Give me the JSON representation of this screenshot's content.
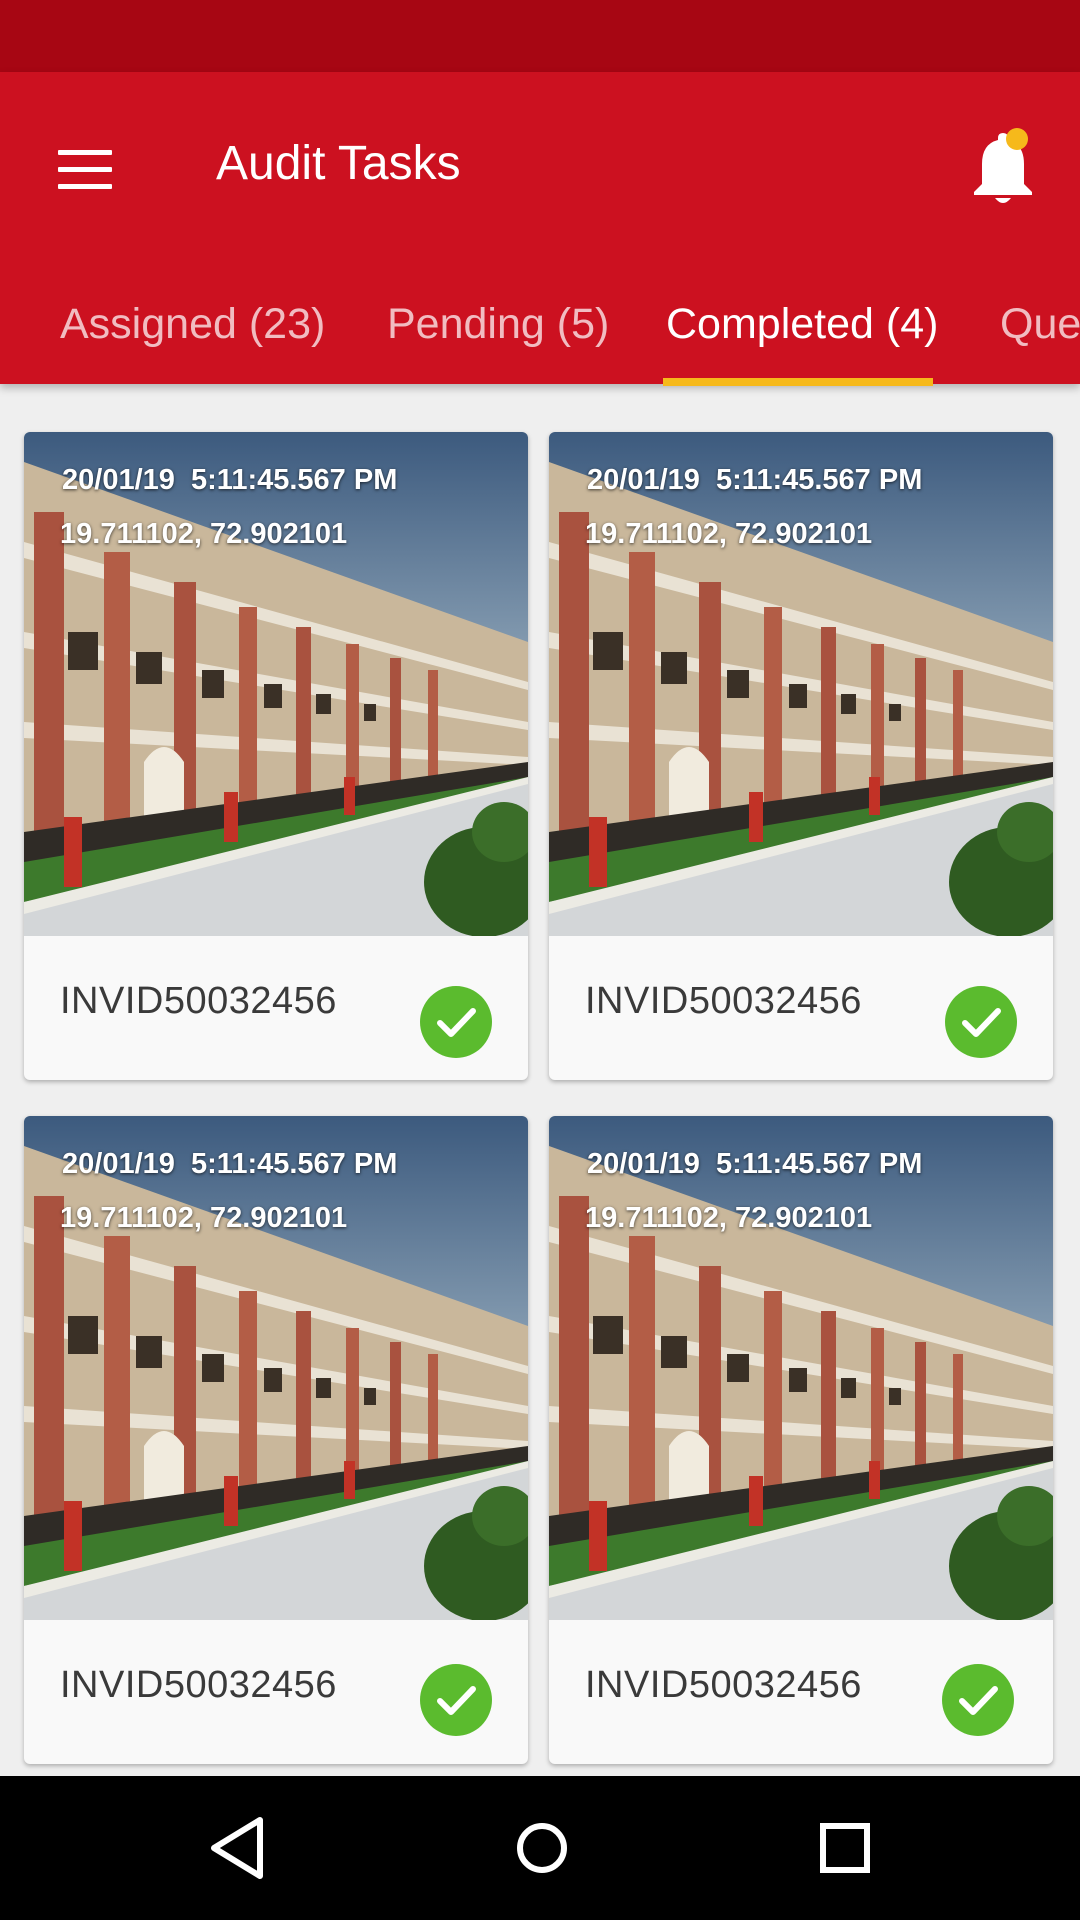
{
  "app_bar": {
    "title": "Audit Tasks",
    "menu_icon": "hamburger-menu-icon",
    "notification_icon": "bell-icon",
    "notification_badge_color": "#f6b91b"
  },
  "tabs": [
    {
      "label": "Assigned (23)",
      "active": false
    },
    {
      "label": "Pending (5)",
      "active": false
    },
    {
      "label": "Completed (4)",
      "active": true
    },
    {
      "label": "Queued",
      "active": false
    }
  ],
  "cards": [
    {
      "timestamp": "20/01/19  5:11:45.567 PM",
      "coordinates": "19.711102, 72.902101",
      "invoice_id": "INVID50032456",
      "status": "completed",
      "status_icon": "check-circle-icon"
    },
    {
      "timestamp": "20/01/19  5:11:45.567 PM",
      "coordinates": "19.711102, 72.902101",
      "invoice_id": "INVID50032456",
      "status": "completed",
      "status_icon": "check-circle-icon"
    },
    {
      "timestamp": "20/01/19  5:11:45.567 PM",
      "coordinates": "19.711102, 72.902101",
      "invoice_id": "INVID50032456",
      "status": "completed",
      "status_icon": "check-circle-icon"
    },
    {
      "timestamp": "20/01/19  5:11:45.567 PM",
      "coordinates": "19.711102, 72.902101",
      "invoice_id": "INVID50032456",
      "status": "completed",
      "status_icon": "check-circle-icon"
    }
  ],
  "nav_bar": {
    "back_icon": "back-triangle-icon",
    "home_icon": "home-circle-icon",
    "recents_icon": "recents-square-icon"
  },
  "colors": {
    "primary": "#cc1120",
    "primary_dark": "#a70613",
    "accent": "#f6b91b",
    "success": "#5bbb2e"
  }
}
